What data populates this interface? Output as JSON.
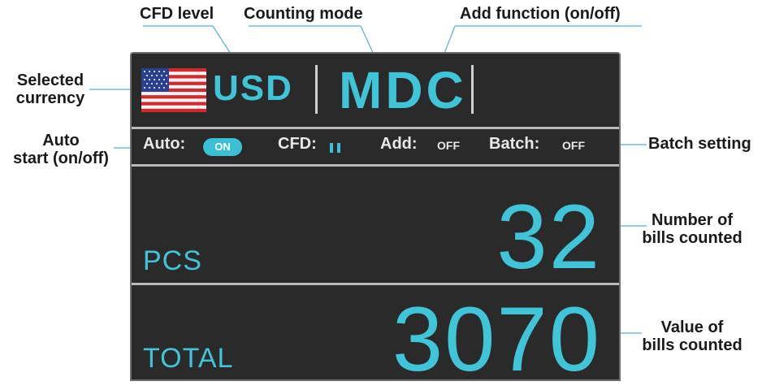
{
  "display": {
    "currency": "USD",
    "mode": "MDC",
    "status": {
      "auto_label": "Auto:",
      "auto_value": "ON",
      "cfd_label": "CFD:",
      "cfd_level": 2,
      "add_label": "Add:",
      "add_value": "OFF",
      "batch_label": "Batch:",
      "batch_value": "OFF"
    },
    "pcs_label": "PCS",
    "pcs_value": "32",
    "total_label": "TOTAL",
    "total_value": "3070"
  },
  "callouts": {
    "cfd_level": "CFD level",
    "counting_mode": "Counting mode",
    "add_function": "Add function (on/off)",
    "selected_currency": [
      "Selected",
      "currency"
    ],
    "auto_start": [
      "Auto",
      "start (on/off)"
    ],
    "batch_setting": "Batch setting",
    "number_of_bills": [
      "Number of",
      "bills counted"
    ],
    "value_of_bills": [
      "Value of",
      "bills counted"
    ]
  },
  "colors": {
    "accent": "#40c4d8",
    "screen_bg": "#2a2a2a",
    "callout_line": "#5aaed6"
  },
  "icons": {
    "flag": "us-flag-icon"
  }
}
